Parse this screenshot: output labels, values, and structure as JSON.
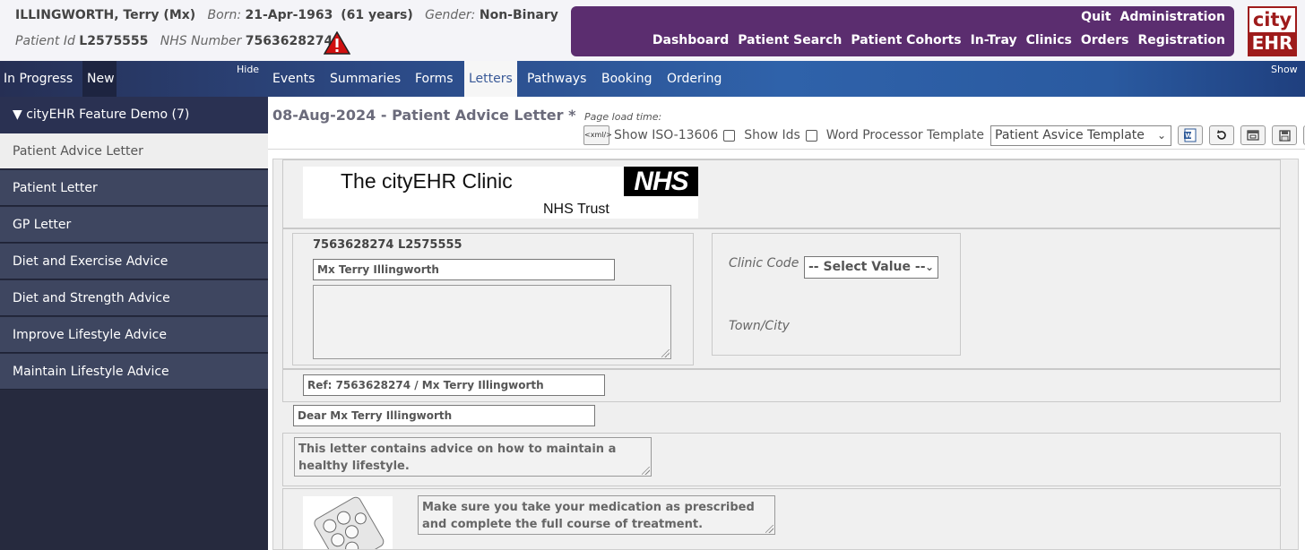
{
  "patient": {
    "name": "ILLINGWORTH,  Terry  (Mx)",
    "born_label": "Born:",
    "born": "21-Apr-1963",
    "age": "(61 years)",
    "gender_label": "Gender:",
    "gender": "Non-Binary",
    "id_label": "Patient Id",
    "id": "L2575555",
    "nhs_label": "NHS Number",
    "nhs": "7563628274"
  },
  "topnav": {
    "row1": [
      "Quit",
      "Administration"
    ],
    "row2": [
      "Dashboard",
      "Patient Search",
      "Patient Cohorts",
      "In-Tray",
      "Clinics",
      "Orders",
      "Registration"
    ]
  },
  "logo": {
    "line1": "city",
    "line2": "EHR",
    "color": "#9e1b1b"
  },
  "tabs": {
    "left": [
      "In Progress",
      "New"
    ],
    "hide": "Hide",
    "show": "Show",
    "main": [
      "Events",
      "Summaries",
      "Forms",
      "Letters",
      "Pathways",
      "Booking",
      "Ordering"
    ],
    "active": "Letters"
  },
  "sidebar": {
    "header": "▼ cityEHR Feature Demo (7)",
    "items": [
      "Patient Advice Letter",
      "Patient Letter",
      "GP Letter",
      "Diet and Exercise Advice",
      "Diet and Strength Advice",
      "Improve Lifestyle Advice",
      "Maintain Lifestyle Advice"
    ],
    "selected_index": 0
  },
  "document": {
    "title": "08-Aug-2024 - Patient Advice Letter *",
    "load_time": "Page load time:",
    "toolbar": {
      "xml_label": "<xml/>",
      "show_iso": "Show ISO-13606",
      "show_ids": "Show Ids",
      "wp_template": "Word Processor Template",
      "template_value": "Patient Asvice Template"
    },
    "letterhead": {
      "clinic": "The cityEHR Clinic",
      "nhs_logo": "NHS",
      "nhs_trust": "NHS Trust"
    },
    "address": {
      "ids": "7563628274 L2575555",
      "name_value": "Mx Terry Illingworth"
    },
    "clinic": {
      "code_label": "Clinic Code",
      "code_value": "-- Select Value --",
      "town_label": "Town/City"
    },
    "ref_value": "Ref: 7563628274 / Mx Terry Illingworth",
    "salutation_value": "Dear Mx Terry Illingworth",
    "intro_text": "This letter contains advice on how to maintain a healthy lifestyle.",
    "medication_text": "Make sure you take your medication as prescribed and complete the full course of treatment."
  },
  "colors": {
    "nav_purple": "#5b2d6f",
    "sidebar_dark": "#262a3e",
    "sidebar_item": "#3e4660",
    "tab_blue": "#2f62aa"
  }
}
